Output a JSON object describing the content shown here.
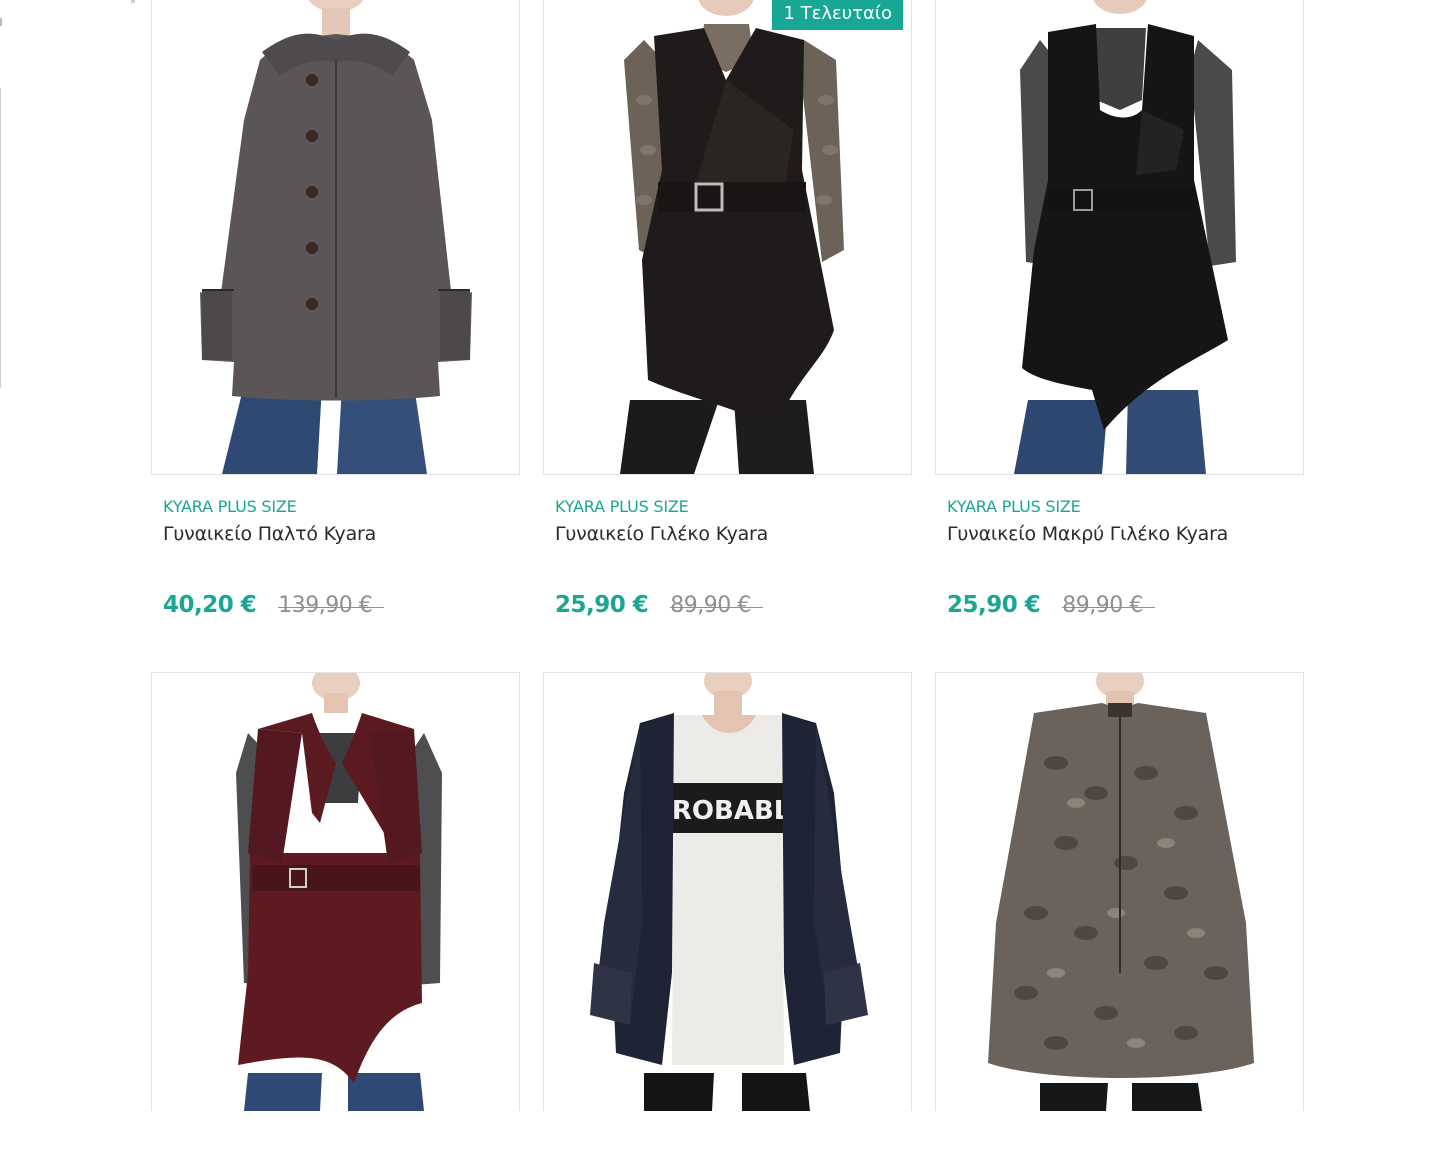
{
  "colors": {
    "accent": "#1aa693",
    "badge_bg": "#19a795",
    "old_price": "#8f8f8f",
    "title": "#2b2b2b",
    "border": "#e2e2e2"
  },
  "products": [
    {
      "brand": "KYARA PLUS SIZE",
      "title": "Γυναικείο Παλτό Kyara",
      "price": "40,20 €",
      "old_price": "139,90 €",
      "image": "grey-coat-photo"
    },
    {
      "badge": "1 Τελευταίο",
      "brand": "KYARA PLUS SIZE",
      "title": "Γυναικείο Γιλέκο Kyara",
      "price": "25,90 €",
      "old_price": "89,90 €",
      "image": "black-belted-vest-photo"
    },
    {
      "brand": "KYARA PLUS SIZE",
      "title": "Γυναικείο Μακρύ Γιλέκο Kyara",
      "price": "25,90 €",
      "old_price": "89,90 €",
      "image": "black-long-vest-photo"
    },
    {
      "image": "burgundy-vest-photo"
    },
    {
      "image": "navy-jacket-tshirt-photo",
      "tshirt_text": "PROBABLY"
    },
    {
      "image": "snake-print-blouse-photo"
    }
  ]
}
